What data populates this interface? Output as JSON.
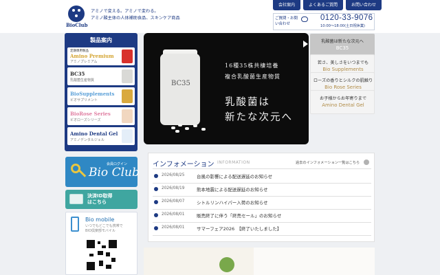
{
  "header": {
    "logo_text": "BioClub",
    "tagline_line1": "アミノで変える。アミノで変わる。",
    "tagline_line2": "アミノ酸主体の人体補助食品、スキンケア商品",
    "nav": [
      "会社案内",
      "よくあるご質問",
      "お問い合わせ"
    ],
    "contact_label": "ご質問・お問い合わせ",
    "phone": "0120-33-9076",
    "hours": "10:00～18:00(土日祝休業)"
  },
  "products": {
    "title": "製品案内",
    "items": [
      {
        "name": "Amino Premium",
        "sub": "アミノプレミアム",
        "tag": "定期専用製品",
        "color": "#d4a533"
      },
      {
        "name": "BC35",
        "sub": "乳酸菌生産物質",
        "tag": "",
        "color": "#2a2a2a"
      },
      {
        "name": "BioSupplements",
        "sub": "ビオサプリメント",
        "tag": "",
        "color": "#5ba0d8"
      },
      {
        "name": "BioRose Series",
        "sub": "ビオローズシリーズ",
        "tag": "",
        "color": "#e07fa2"
      },
      {
        "name": "Amino Dental Gel",
        "sub": "アミノデンタルジェル",
        "tag": "",
        "color": "#1d3a83"
      }
    ]
  },
  "bio_club": {
    "sub": "会員ログイン",
    "title": "Bio Club"
  },
  "kessai": {
    "line1": "決済ID取得",
    "line2": "はこちら"
  },
  "mobile": {
    "title": "Bio mobile",
    "sub1": "いつでもどこでも携帯で",
    "sub2": "BIO倶楽部モバイル"
  },
  "hero": {
    "bottle_label": "BC35",
    "line1": "16種35株共棲培養",
    "line2": "複合乳酸菌生産物質",
    "line3": "乳酸菌は",
    "line4": "新たな次元へ"
  },
  "slides": [
    {
      "l1": "乳酸菌は新たな次元へ",
      "l2": "BC35",
      "active": true
    },
    {
      "l1": "若さ、美しさをいつまでも",
      "l2": "Bio Supplements",
      "active": false
    },
    {
      "l1": "ローズの香りとシルクの肌触り",
      "l2": "Bio Rose Series",
      "active": false
    },
    {
      "l1": "お子様からお年寄りまで",
      "l2": "Amino Dental Gel",
      "active": false
    }
  ],
  "information": {
    "title": "インフォメーション",
    "title_en": "INFORMATION",
    "past_link": "過去のインフォメーション一覧はこちら",
    "news": [
      {
        "date": "2026/08/25",
        "text": "台風の影響による配送遅延のお知らせ"
      },
      {
        "date": "2026/08/19",
        "text": "熊本地震による配送遅延のお知らせ"
      },
      {
        "date": "2026/08/07",
        "text": "シトルリンハイパー入荷のお知らせ"
      },
      {
        "date": "2026/08/01",
        "text": "販売終了に伴う「終売セール」のお知らせ"
      },
      {
        "date": "2026/08/01",
        "text": "サマーフェア2026　【終了いたしました】"
      }
    ]
  }
}
